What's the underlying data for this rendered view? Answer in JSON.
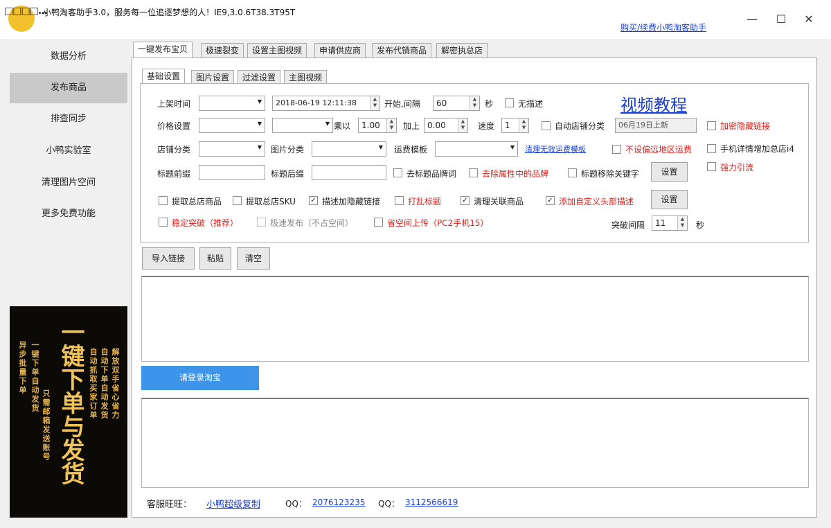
{
  "window": {
    "title": "小鸭淘客助手3.0，服务每一位追逐梦想的人！IE9,3.0.6T38.3T95T",
    "logo_text": "□□□□...",
    "buy_link": "购买/续费小鸭淘客助手",
    "min_icon": "—",
    "max_icon": "☐",
    "close_icon": "✕"
  },
  "sidebar": {
    "items": [
      {
        "label": "数据分析"
      },
      {
        "label": "发布商品"
      },
      {
        "label": "排查同步"
      },
      {
        "label": "小鸭实验室"
      },
      {
        "label": "清理图片空间"
      },
      {
        "label": "更多免费功能"
      }
    ],
    "active_index": 1
  },
  "promo": {
    "big_text": "一键下单与发货",
    "col1": "异步批量下单",
    "col2": "一键下单自动发货",
    "col3": "只需邮箱发送账号",
    "col4": "自动抓取买家订单",
    "col5": "自动下单自动发货",
    "col6": "解放双手省心省力"
  },
  "main_tabs": [
    "一键发布宝贝",
    "极速裂变",
    "设置主图视频",
    "申请供应商",
    "发布代销商品",
    "解密执总店"
  ],
  "sub_tabs": [
    "基础设置",
    "图片设置",
    "过滤设置",
    "主图视频"
  ],
  "form": {
    "shelf_time_label": "上架时间",
    "datetime_value": "2018-06-19 12:11:38",
    "start_interval_label": "开始,间隔",
    "interval_value": "60",
    "seconds_label": "秒",
    "no_desc_label": "无描述",
    "video_tutorial": "视频教程",
    "price_setting_label": "价格设置",
    "multiply_label": "乘以",
    "multiply_value": "1.00",
    "add_label": "加上",
    "add_value": "0.00",
    "speed_label": "速度",
    "speed_value": "1",
    "auto_shop_cat_label": "自动店铺分类",
    "auto_shop_cat_value": "06月19日上新",
    "encrypt_hidden_link": "加密隐藏链接",
    "shop_category_label": "店铺分类",
    "image_category_label": "图片分类",
    "freight_template_label": "运费模板",
    "clear_invalid_freight": "清理无效运费模板",
    "no_remote_freight": "不设偏远地区运费",
    "mobile_detail_label": "手机详情增加总店i4",
    "title_prefix_label": "标题前缀",
    "title_suffix_label": "标题后缀",
    "remove_brand_words": "去标题品牌词",
    "remove_brand_attr": "去除属性中的品牌",
    "title_remove_keywords": "标题移除关键字",
    "settings_button": "设置",
    "strong_traffic": "强力引流",
    "fetch_total_items": "提取总店商品",
    "fetch_total_sku": "提取总店SKU",
    "desc_hidden_link": "描述加隐藏链接",
    "shuffle_title": "打乱标题",
    "clear_related_items": "清理关联商品",
    "add_custom_header_desc": "添加自定义头部描述",
    "settings_button_2": "设置",
    "stable_breakthrough": "稳定突破（推荐）",
    "fast_publish": "极速发布（不占空间）",
    "save_space_upload": "省空间上传（PC2手机15）",
    "break_interval_label": "突破间隔",
    "break_interval_value": "11",
    "break_seconds_label": "秒"
  },
  "actions": {
    "import_link": "导入链接",
    "paste": "粘贴",
    "clear": "清空",
    "login_taobao": "请登录淘宝"
  },
  "footer": {
    "service_label": "客服旺旺：",
    "service_name": "小鸭超级复制",
    "qq_label_1": "QQ：",
    "qq_1": "2076123235",
    "qq_label_2": "QQ：",
    "qq_2": "3112566619"
  },
  "colors": {
    "login_button": "#3d94e8",
    "link": "#1a3fd6",
    "warning_text": "#e0201c",
    "sidebar_active": "#c9c9c9"
  }
}
